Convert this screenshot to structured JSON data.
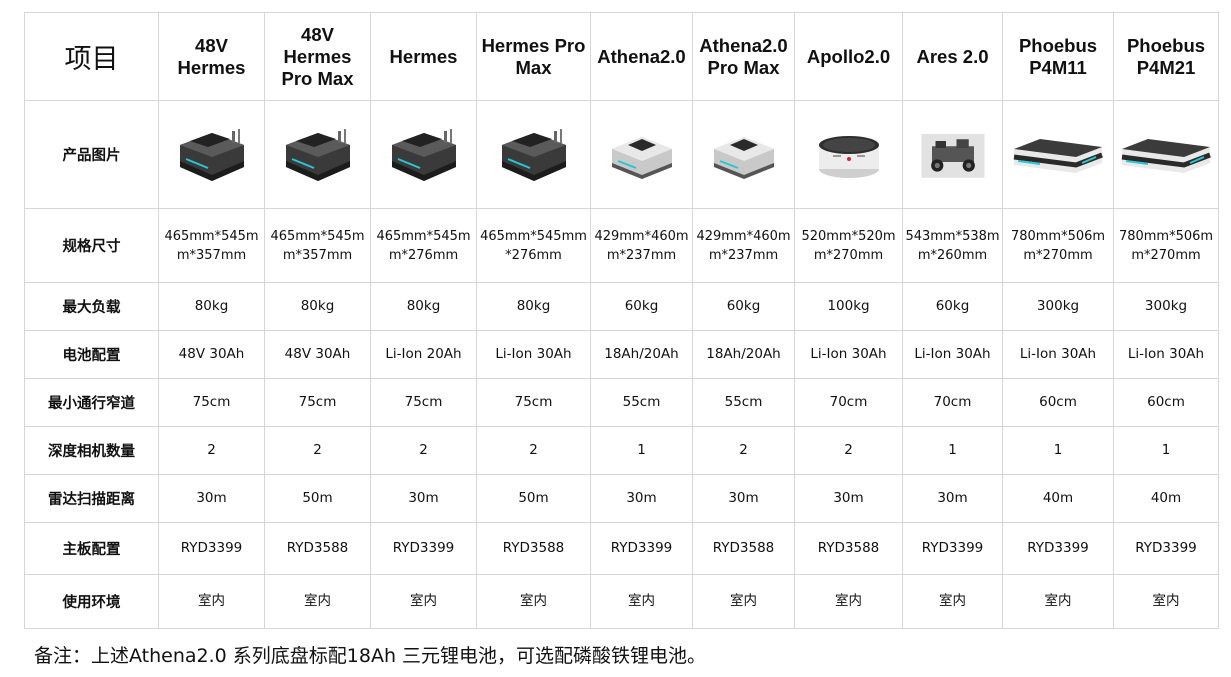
{
  "table": {
    "header_label": "项目",
    "models": [
      "48V Hermes",
      "48V Hermes Pro Max",
      "Hermes",
      "Hermes Pro Max",
      "Athena2.0",
      "Athena2.0 Pro Max",
      "Apollo2.0",
      "Ares 2.0",
      "Phoebus P4M11",
      "Phoebus P4M21"
    ],
    "image_row_label": "产品图片",
    "product_images": [
      "hermes-robot-image",
      "hermes-robot-image",
      "hermes-robot-image",
      "hermes-robot-image",
      "athena-robot-image",
      "athena-robot-image",
      "apollo-robot-image",
      "ares-robot-image",
      "phoebus-robot-image",
      "phoebus-robot-image"
    ],
    "rows": [
      {
        "label": "规格尺寸",
        "values": [
          "465mm*545mm*357mm",
          "465mm*545mm*357mm",
          "465mm*545mm*276mm",
          "465mm*545mm*276mm",
          "429mm*460mm*237mm",
          "429mm*460mm*237mm",
          "520mm*520mm*270mm",
          "543mm*538mm*260mm",
          "780mm*506mm*270mm",
          "780mm*506mm*270mm"
        ]
      },
      {
        "label": "最大负载",
        "values": [
          "80kg",
          "80kg",
          "80kg",
          "80kg",
          "60kg",
          "60kg",
          "100kg",
          "60kg",
          "300kg",
          "300kg"
        ]
      },
      {
        "label": "电池配置",
        "values": [
          "48V 30Ah",
          "48V 30Ah",
          "Li-Ion 20Ah",
          "Li-Ion 30Ah",
          "18Ah/20Ah",
          "18Ah/20Ah",
          "Li-Ion 30Ah",
          "Li-Ion 30Ah",
          "Li-Ion 30Ah",
          "Li-Ion 30Ah"
        ]
      },
      {
        "label": "最小通行窄道",
        "values": [
          "75cm",
          "75cm",
          "75cm",
          "75cm",
          "55cm",
          "55cm",
          "70cm",
          "70cm",
          "60cm",
          "60cm"
        ]
      },
      {
        "label": "深度相机数量",
        "values": [
          "2",
          "2",
          "2",
          "2",
          "1",
          "2",
          "2",
          "1",
          "1",
          "1"
        ]
      },
      {
        "label": "雷达扫描距离",
        "values": [
          "30m",
          "50m",
          "30m",
          "50m",
          "30m",
          "30m",
          "30m",
          "30m",
          "40m",
          "40m"
        ]
      },
      {
        "label": "主板配置",
        "values": [
          "RYD3399",
          "RYD3588",
          "RYD3399",
          "RYD3588",
          "RYD3399",
          "RYD3588",
          "RYD3588",
          "RYD3399",
          "RYD3399",
          "RYD3399"
        ]
      },
      {
        "label": "使用环境",
        "values": [
          "室内",
          "室内",
          "室内",
          "室内",
          "室内",
          "室内",
          "室内",
          "室内",
          "室内",
          "室内"
        ]
      }
    ]
  },
  "footnote": "备注：上述Athena2.0 系列底盘标配18Ah 三元锂电池，可选配磷酸铁锂电池。"
}
